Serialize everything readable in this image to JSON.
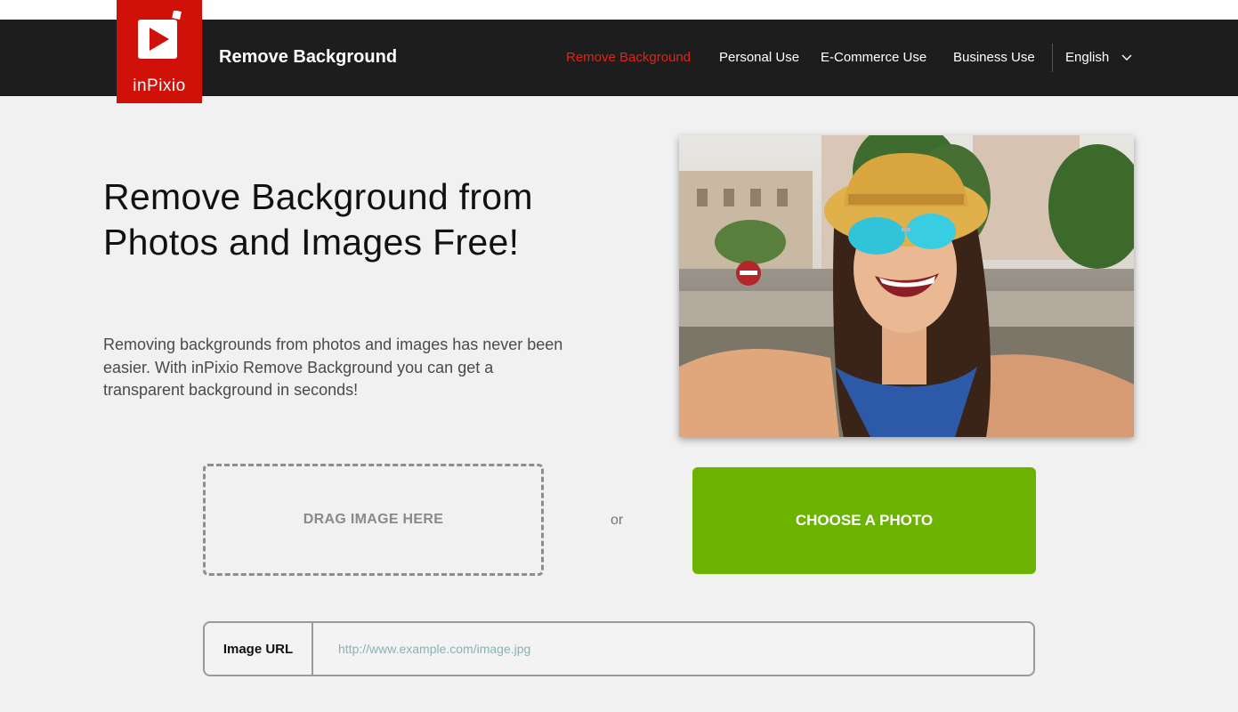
{
  "brand": {
    "logo_text": "inPixio",
    "title": "Remove Background",
    "accent_color": "#d0110a"
  },
  "nav": {
    "items": [
      {
        "label": "Remove Background",
        "active": true
      },
      {
        "label": "Personal Use",
        "active": false
      },
      {
        "label": "E-Commerce Use",
        "active": false
      },
      {
        "label": "Business Use",
        "active": false
      }
    ],
    "language": "English",
    "language_icon": "chevron-down-icon"
  },
  "hero": {
    "title": "Remove Background from Photos and Images Free!",
    "description": "Removing backgrounds from photos and images has never been easier. With inPixio Remove Background you can get a transparent background in seconds!"
  },
  "upload": {
    "drop_label": "DRAG IMAGE HERE",
    "or_label": "or",
    "choose_label": "CHOOSE A PHOTO",
    "choose_color": "#6bb300"
  },
  "url_input": {
    "label": "Image URL",
    "placeholder": "http://www.example.com/image.jpg",
    "value": ""
  }
}
